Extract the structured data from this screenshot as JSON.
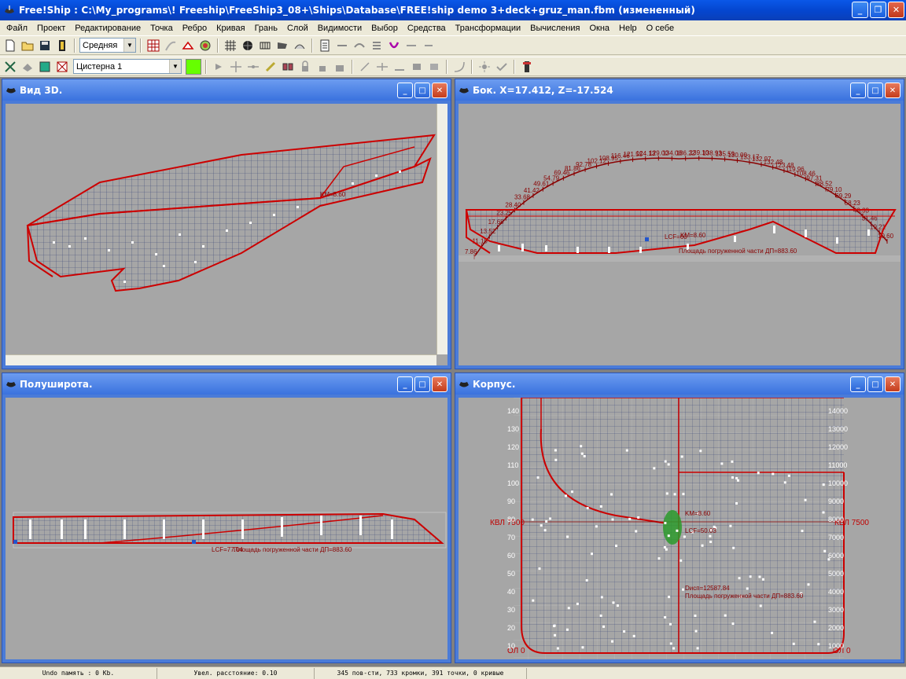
{
  "window": {
    "title": "Free!Ship  : C:\\My_programs\\! Freeship\\FreeShip3_08+\\Ships\\Database\\FREE!ship demo 3+deck+gruz_man.fbm (измененный)",
    "minimize": "_",
    "maximize": "❐",
    "close": "✕"
  },
  "menu": [
    "Файл",
    "Проект",
    "Редактирование",
    "Точка",
    "Ребро",
    "Кривая",
    "Грань",
    "Слой",
    "Видимости",
    "Выбор",
    "Средства",
    "Трансформации",
    "Вычисления",
    "Окна",
    "Help",
    "О себе"
  ],
  "toolbar": {
    "precision_value": "Средняя",
    "layer_value": "Цистерна 1",
    "layer_color": "#66ff00"
  },
  "viewports": {
    "view3d": {
      "title": "Вид 3D."
    },
    "profile": {
      "title": "Бок.  X=17.412,  Z=-17.524",
      "lcf_label": "LCF=60",
      "km_label": "KM=8.60",
      "area_label": "Площадь погруженной части ДП=883.60",
      "arc_values": [
        "7.86",
        "11.10",
        "13.52",
        "17.68",
        "23.25",
        "28.40",
        "33.68",
        "41.42",
        "49.61",
        "54.79",
        "69.46",
        "81.86",
        "92.78",
        "102.12",
        "108.95",
        "116.46",
        "121.55",
        "124.13",
        "129.00",
        "134.08",
        "136.22",
        "139.10",
        "138.93",
        "135.59",
        "130.00",
        "133.17",
        "132.97",
        "132.48",
        "123.48",
        "119.96",
        "108.46",
        "97.31",
        "88.52",
        "79.10",
        "69.29",
        "58.23",
        "43.33",
        "31.46",
        "19.21",
        "10.60"
      ]
    },
    "plan": {
      "title": "Полуширота.",
      "lcf_label": "LCF=77.04",
      "area_label": "Площадь погруженной части ДП=883.60"
    },
    "body": {
      "title": "Корпус.",
      "waterline_left": "КВЛ 7500",
      "waterline_right": "КВЛ 7500",
      "baseline_left": "ОЛ 0",
      "baseline_right": "ОЛ 0",
      "km_label": "KM=8.60",
      "lcf_label": "LCF=50.03",
      "disp_label": "Dисп=12587.84",
      "area_label": "Площадь погруженной части ДП=883.60",
      "y_labels": [
        "140",
        "130",
        "120",
        "110",
        "100",
        "90",
        "80",
        "70",
        "60",
        "50",
        "40",
        "30",
        "20",
        "10"
      ],
      "y_labels_right": [
        "14000",
        "13000",
        "12000",
        "11000",
        "10000",
        "9000",
        "8000",
        "7000",
        "6000",
        "5000",
        "4000",
        "3000",
        "2000",
        "1000"
      ]
    }
  },
  "status": {
    "undo": "Undo память : 0 Kb.",
    "distance": "Увел. расстояние: 0.10",
    "counts": "345 пов-сти, 733 кромки, 391 точки, 0 кривые"
  }
}
